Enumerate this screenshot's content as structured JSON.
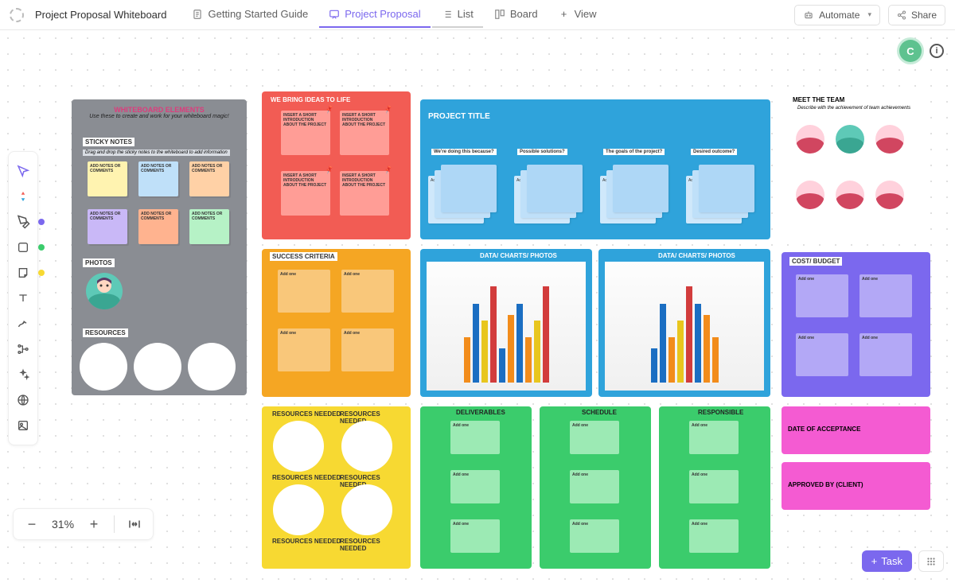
{
  "header": {
    "title": "Project Proposal Whiteboard",
    "tabs": [
      {
        "label": "Getting Started Guide",
        "active": false
      },
      {
        "label": "Project Proposal",
        "active": true
      },
      {
        "label": "List",
        "active": false
      },
      {
        "label": "Board",
        "active": false
      },
      {
        "label": "View",
        "active": false,
        "add": true
      }
    ],
    "automate": "Automate",
    "share": "Share"
  },
  "user": {
    "initial": "C"
  },
  "zoom": {
    "level": "31%"
  },
  "taskbtn": "Task",
  "elements_panel": {
    "title": "WHITEBOARD ELEMENTS",
    "subtitle": "Use these to create and work for your whiteboard magic!",
    "sticky_label": "STICKY NOTES",
    "sticky_sub": "Drag and drop the sticky notes to the whiteboard to add information",
    "note_text": "ADD NOTES OR COMMENTS",
    "photos_label": "PHOTOS",
    "resources_label": "RESOURCES",
    "sticky_colors": [
      "#fff3b0",
      "#bfe0f9",
      "#ffd1a6",
      "#c9b8f7",
      "#ffb38f",
      "#b6f2c6"
    ]
  },
  "ideas_panel": {
    "title": "WE BRING IDEAS TO LIFE",
    "note_text": "INSERT A SHORT INTRODUCTION ABOUT THE PROJECT",
    "bg": "#f25c54",
    "note_bg": "#ff9d96"
  },
  "project_panel": {
    "title": "PROJECT TITLE",
    "columns": [
      "We're doing this because?",
      "Possible solutions?",
      "The goals of the project?",
      "Desired outcome?"
    ],
    "pile_text": "Add one",
    "bg": "#2fa3db"
  },
  "team_panel": {
    "title": "MEET THE TEAM",
    "subtitle": "Describe with the achievement of team achievements"
  },
  "success_panel": {
    "title": "SUCCESS CRITERIA",
    "note_text": "Add one",
    "bg": "#f5a623",
    "note_bg": "#f9c77a"
  },
  "data_panel": {
    "title": "DATA/ CHARTS/ PHOTOS",
    "bg": "#2fa3db"
  },
  "cost_panel": {
    "title": "COST/ BUDGET",
    "note_text": "Add one",
    "bg": "#7b68ee",
    "note_bg": "#b3a8f6"
  },
  "resources_panel": {
    "title": "RESOURCES NEEDED",
    "bg": "#f7d932"
  },
  "deliverables_panel": {
    "title": "DELIVERABLES",
    "bg": "#3bcc6c",
    "note_bg": "#9ceab4",
    "note_text": "Add one"
  },
  "schedule_panel": {
    "title": "SCHEDULE",
    "bg": "#3bcc6c",
    "note_bg": "#9ceab4",
    "note_text": "Add one"
  },
  "responsible_panel": {
    "title": "RESPONSIBLE",
    "bg": "#3bcc6c",
    "note_bg": "#9ceab4",
    "note_text": "Add one"
  },
  "acceptance_panel": {
    "title": "DATE OF ACCEPTANCE",
    "bg": "#f45bd2"
  },
  "approved_panel": {
    "title": "APPROVED BY (CLIENT)",
    "bg": "#f45bd2"
  }
}
